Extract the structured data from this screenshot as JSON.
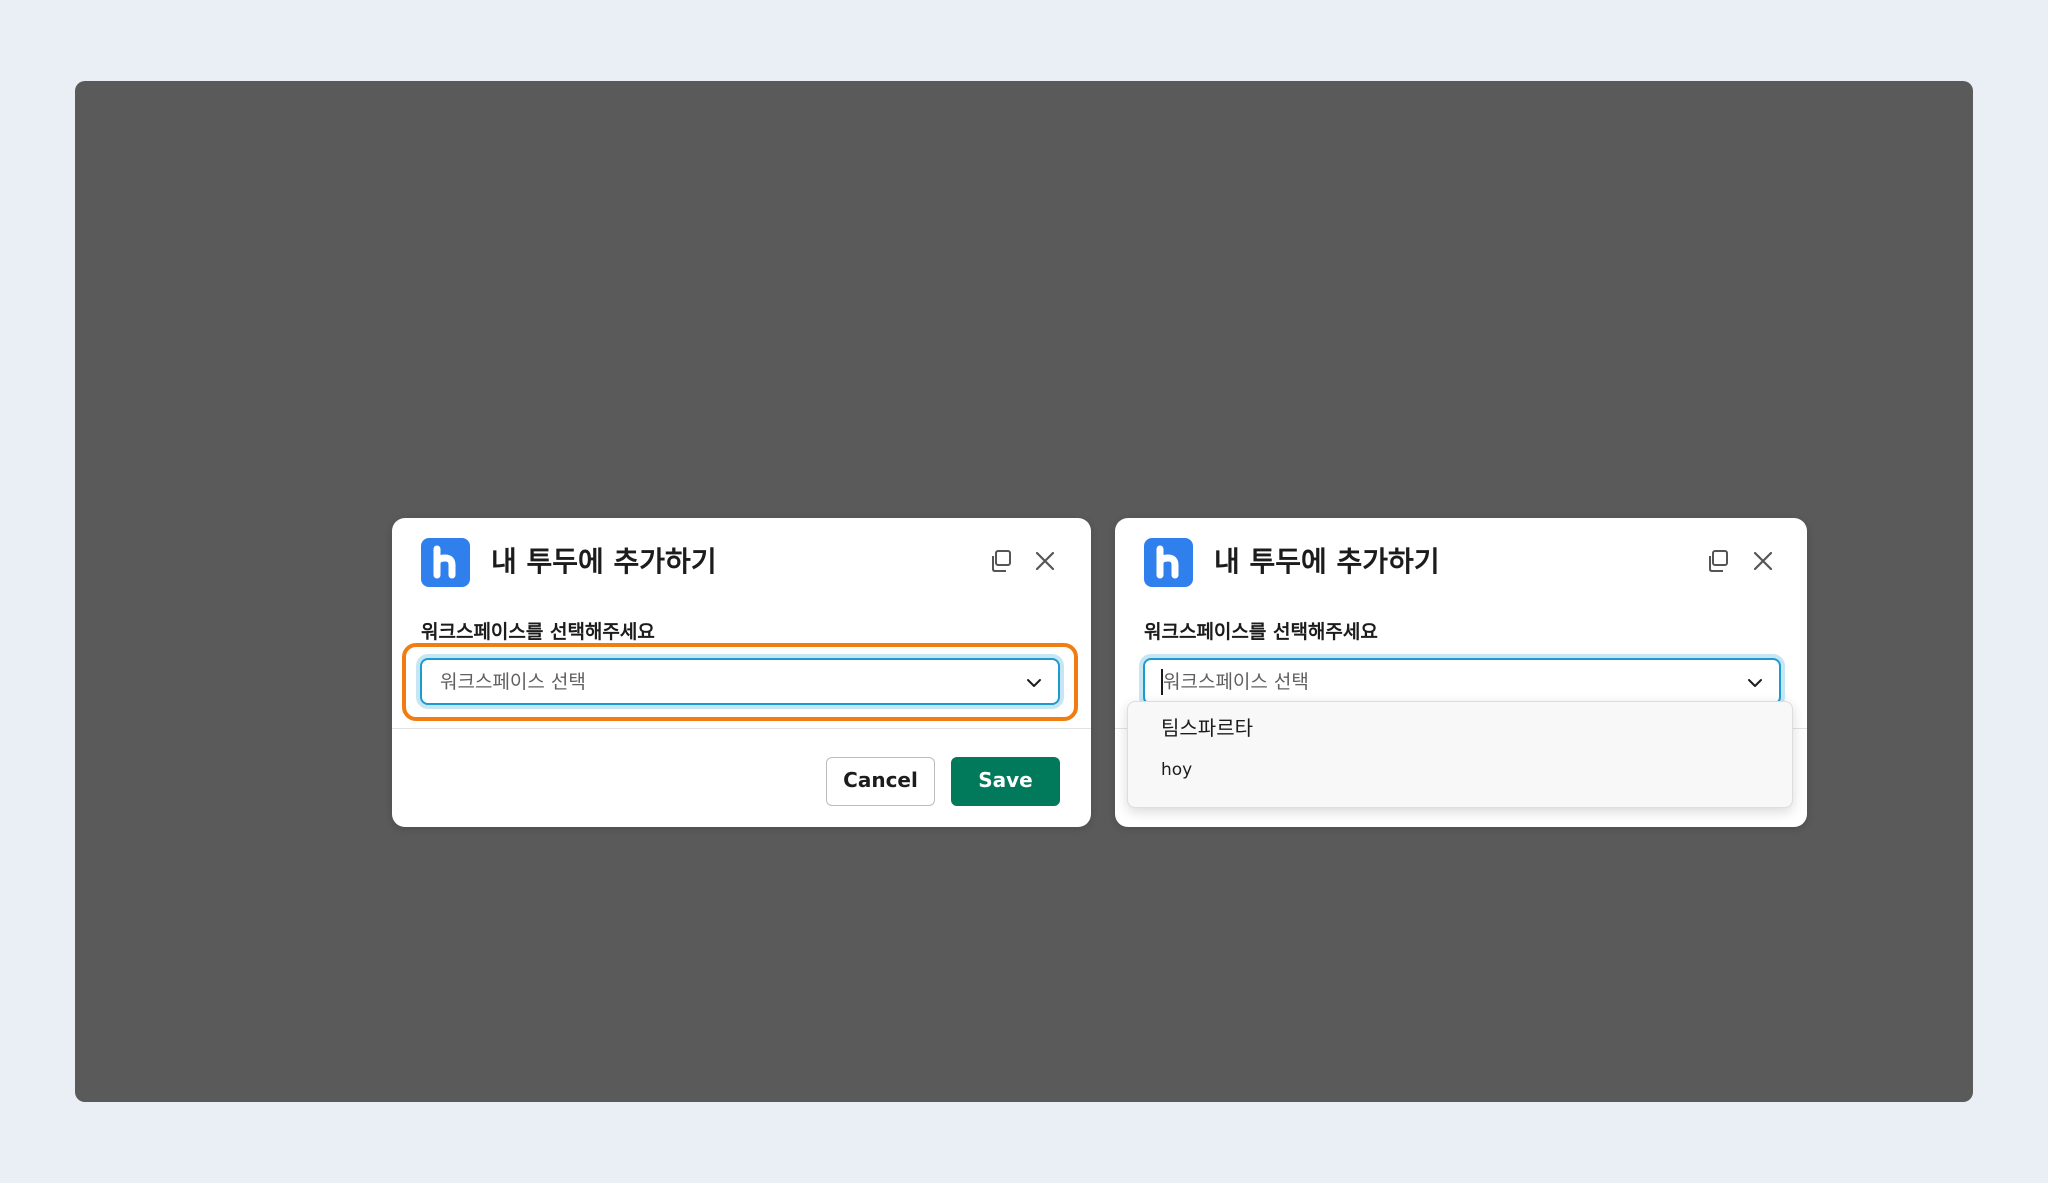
{
  "colors": {
    "page_background": "#eaeef5",
    "stage_background": "#5a5a5a",
    "app_logo": "#2f80ed",
    "save_button": "#007a5a",
    "focus_ring": "#1d9bd1",
    "highlight": "#f07c12"
  },
  "modal_left": {
    "title": "내 투두에 추가하기",
    "icons": [
      "app-logo-icon",
      "copy-icon",
      "close-icon"
    ],
    "field_label": "워크스페이스를 선택해주세요",
    "select_placeholder": "워크스페이스 선택",
    "cancel_label": "Cancel",
    "save_label": "Save"
  },
  "modal_right": {
    "title": "내 투두에 추가하기",
    "icons": [
      "app-logo-icon",
      "copy-icon",
      "close-icon"
    ],
    "field_label": "워크스페이스를 선택해주세요",
    "select_placeholder": "워크스페이스 선택",
    "dropdown_options": [
      "팀스파르타",
      "hoy"
    ]
  }
}
